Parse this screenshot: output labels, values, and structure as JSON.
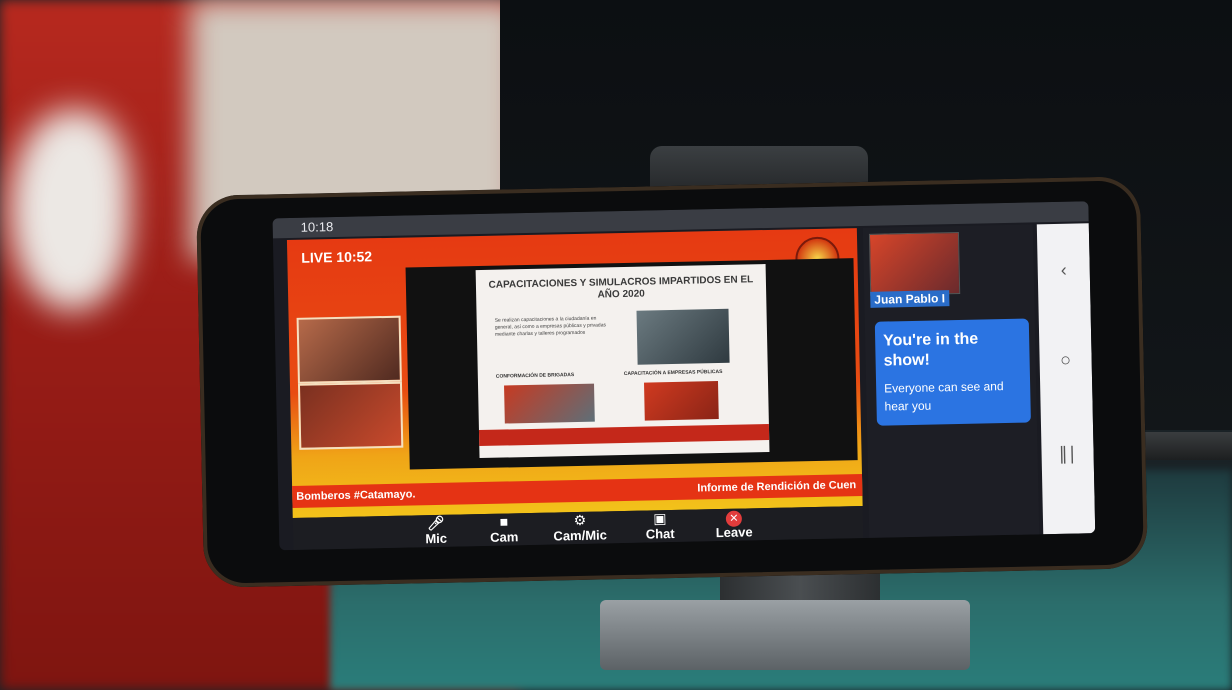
{
  "status_bar": {
    "time": "10:18",
    "icons": ""
  },
  "stream": {
    "live_label": "LIVE 10:52",
    "footer_left": "Bomberos #Catamayo.",
    "footer_right": "Informe de Rendición de Cuen"
  },
  "slide": {
    "title": "CAPACITACIONES Y SIMULACROS IMPARTIDOS EN EL AÑO 2020",
    "body": "Se realizan capacitaciones a la ciudadanía en general, así como a empresas públicas y privadas mediante charlas y talleres programados",
    "subtitle_left": "CONFORMACIÓN DE BRIGADAS",
    "subtitle_right": "CAPACITACIÓN A EMPRESAS PÚBLICAS"
  },
  "controls": [
    {
      "label": "Mic",
      "icon": "mic-icon"
    },
    {
      "label": "Cam",
      "icon": "camera-icon"
    },
    {
      "label": "Cam/Mic",
      "icon": "gear-icon"
    },
    {
      "label": "Chat",
      "icon": "chat-icon"
    },
    {
      "label": "Leave",
      "icon": "close-icon"
    }
  ],
  "participant": {
    "name": "Juan Pablo I"
  },
  "toast": {
    "title": "You're in the show!",
    "message": "Everyone can see and hear you"
  },
  "nav": {
    "back_icon": "back-icon",
    "home_icon": "home-icon",
    "recents_icon": "recents-icon"
  },
  "colors": {
    "stage_red": "#e63a12",
    "stage_yellow": "#f2c21a",
    "toast_blue": "#2b74e2",
    "leave_red": "#e23c3c"
  }
}
